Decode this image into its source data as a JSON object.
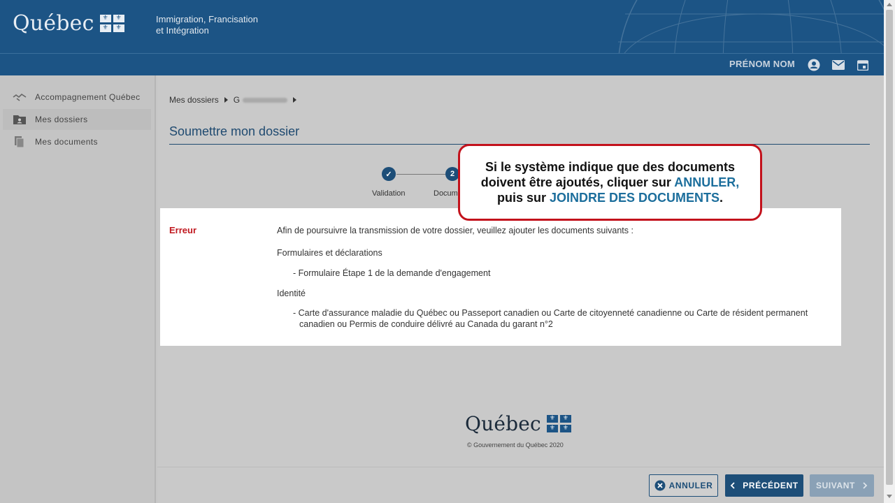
{
  "header": {
    "logo_text": "Québec",
    "ministry_line1": "Immigration, Francisation",
    "ministry_line2": "et Intégration",
    "username": "PRÉNOM NOM",
    "icons": [
      "account-icon",
      "mail-icon",
      "calendar-icon"
    ]
  },
  "sidebar": {
    "items": [
      {
        "label": "Accompagnement Québec",
        "icon": "handshake-icon",
        "active": false
      },
      {
        "label": "Mes dossiers",
        "icon": "folder-user-icon",
        "active": true
      },
      {
        "label": "Mes documents",
        "icon": "documents-icon",
        "active": false
      }
    ]
  },
  "breadcrumb": {
    "root": "Mes dossiers",
    "current": "G"
  },
  "page": {
    "title": "Soumettre mon dossier"
  },
  "stepper": {
    "steps": [
      {
        "label": "Validation",
        "marker": "✓"
      },
      {
        "label": "Docum",
        "marker": "2"
      }
    ]
  },
  "error": {
    "label": "Erreur",
    "intro": "Afin de poursuivre la transmission de votre dossier, veuillez ajouter les documents suivants :",
    "section1_title": "Formulaires et déclarations",
    "section1_item": "- Formulaire Étape 1 de la demande d'engagement",
    "section2_title": "Identité",
    "section2_item_line1": "- Carte d'assurance maladie du Québec ou Passeport canadien ou Carte de citoyenneté canadienne ou Carte de résident permanent",
    "section2_item_line2": "canadien ou Permis de conduire délivré au Canada du garant n°2"
  },
  "callout": {
    "part1": "Si le système indique que des documents doivent être ajoutés, cliquer sur ",
    "highlight1": "ANNULER,",
    "part2": " puis sur ",
    "highlight2": "JOINDRE DES DOCUMENTS",
    "part3": "."
  },
  "footer": {
    "logo_text": "Québec",
    "copyright": "© Gouvernement du Québec 2020"
  },
  "actions": {
    "cancel_label": "ANNULER",
    "prev_label": "PRÉCÉDENT",
    "next_label": "SUIVANT"
  },
  "colors": {
    "brand_blue": "#1c5485",
    "error_red": "#c0181f",
    "callout_border": "#c3121c",
    "highlight": "#1c6e9c"
  }
}
